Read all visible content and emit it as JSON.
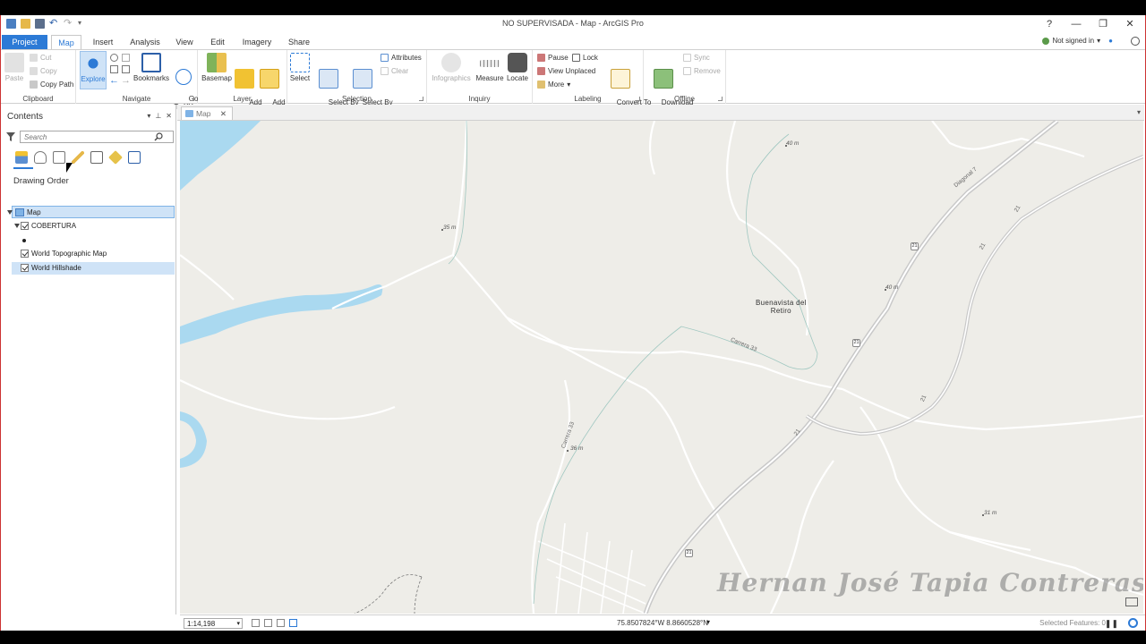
{
  "window": {
    "title": "NO SUPERVISADA - Map - ArcGIS Pro",
    "help": "?",
    "minimize": "—",
    "restore": "❐",
    "close": "✕"
  },
  "tabs": [
    "Project",
    "Map",
    "Insert",
    "Analysis",
    "View",
    "Edit",
    "Imagery",
    "Share"
  ],
  "account": {
    "label": "Not signed in",
    "caret": "▾"
  },
  "ribbon": {
    "clipboard": {
      "label": "Clipboard",
      "paste": "Paste",
      "cut": "Cut",
      "copy": "Copy",
      "copy_path": "Copy Path"
    },
    "navigate": {
      "label": "Navigate",
      "explore": "Explore",
      "bookmarks": "Bookmarks",
      "go_to_xy": "Go\nTo XY"
    },
    "layer": {
      "label": "Layer",
      "basemap": "Basemap",
      "add_data": "Add\nData",
      "add_preset": "Add\nPreset"
    },
    "selection": {
      "label": "Selection",
      "select": "Select",
      "select_by_attributes": "Select By\nAttributes",
      "select_by_location": "Select By\nLocation",
      "attributes": "Attributes",
      "clear": "Clear"
    },
    "inquiry": {
      "label": "Inquiry",
      "infographics": "Infographics",
      "measure": "Measure",
      "locate": "Locate"
    },
    "labeling": {
      "label": "Labeling",
      "pause": "Pause",
      "lock": "Lock",
      "view_unplaced": "View Unplaced",
      "more": "More",
      "convert": "Convert To\nAnnotation"
    },
    "offline": {
      "label": "Offline",
      "download": "Download\nMap",
      "sync": "Sync",
      "remove": "Remove"
    }
  },
  "contents": {
    "title": "Contents",
    "search_placeholder": "Search",
    "drawing_order": "Drawing Order",
    "layers": [
      {
        "name": "Map"
      },
      {
        "name": "COBERTURA"
      },
      {
        "name": "World Topographic Map"
      },
      {
        "name": "World Hillshade"
      }
    ]
  },
  "map_tab": {
    "label": "Map",
    "close": "✕"
  },
  "map": {
    "place": "Buenavista del\nRetiro",
    "elevations": [
      "40 m",
      "35 m",
      "40 m",
      "36 m",
      "31 m"
    ],
    "roads": [
      "Diagonal 7",
      "21",
      "21",
      "Carrera 33",
      "Carrera 33",
      "21",
      "21"
    ],
    "shields": [
      "21",
      "21",
      "21"
    ],
    "watermark": "Hernan José Tapia Contreras"
  },
  "status": {
    "scale": "1:14,198",
    "coordinates": "75.8507824°W 8.8660528°N",
    "selected_features": "Selected Features: 0"
  },
  "colors": {
    "accent": "#2c7ad6",
    "water": "#aad9f0",
    "land": "#eeede8"
  }
}
